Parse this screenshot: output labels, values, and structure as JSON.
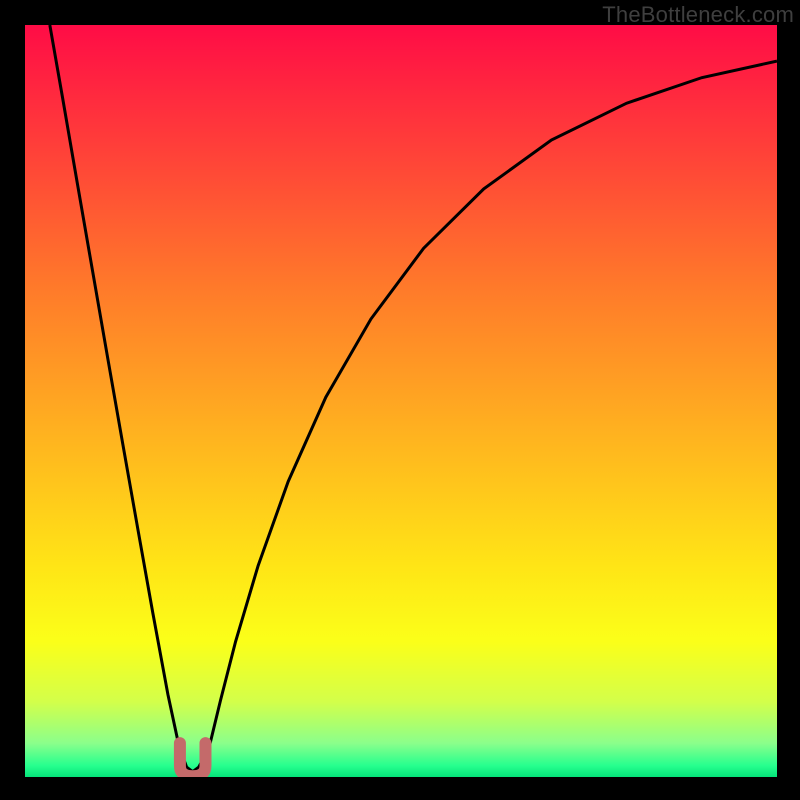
{
  "watermark": "TheBottleneck.com",
  "chart_data": {
    "type": "line",
    "title": "",
    "xlabel": "",
    "ylabel": "",
    "xlim": [
      0,
      100
    ],
    "ylim": [
      0,
      100
    ],
    "grid": false,
    "legend": false,
    "background": {
      "type": "vertical-gradient",
      "stops": [
        {
          "pos": 0.0,
          "color": "#ff0c46"
        },
        {
          "pos": 0.15,
          "color": "#ff3b3a"
        },
        {
          "pos": 0.35,
          "color": "#ff7a2a"
        },
        {
          "pos": 0.55,
          "color": "#ffb41f"
        },
        {
          "pos": 0.72,
          "color": "#ffe516"
        },
        {
          "pos": 0.82,
          "color": "#fbff19"
        },
        {
          "pos": 0.9,
          "color": "#d3ff4a"
        },
        {
          "pos": 0.955,
          "color": "#8bff8b"
        },
        {
          "pos": 0.985,
          "color": "#26ff8e"
        },
        {
          "pos": 1.0,
          "color": "#04e37a"
        }
      ]
    },
    "series": [
      {
        "name": "bottleneck-curve",
        "stroke": "#000000",
        "stroke_width": 3,
        "x": [
          3.3,
          5,
          7,
          9,
          11,
          13,
          15,
          17,
          19,
          20.5,
          21.5,
          22.3,
          23.1,
          24.5,
          26,
          28,
          31,
          35,
          40,
          46,
          53,
          61,
          70,
          80,
          90,
          100
        ],
        "y": [
          100,
          90.3,
          78.7,
          67.2,
          55.7,
          44.3,
          33.0,
          21.8,
          11.0,
          4.0,
          1.3,
          0.7,
          1.3,
          4.0,
          10.2,
          18.0,
          28.1,
          39.3,
          50.5,
          60.9,
          70.3,
          78.2,
          84.7,
          89.6,
          93.0,
          95.2
        ]
      }
    ],
    "marker": {
      "name": "minimum-highlight",
      "shape": "u",
      "color": "#c46a6a",
      "x_center": 22.3,
      "y_center": 2.5,
      "width_x": 3.4,
      "height_y": 4.0,
      "stroke_width": 12
    }
  }
}
